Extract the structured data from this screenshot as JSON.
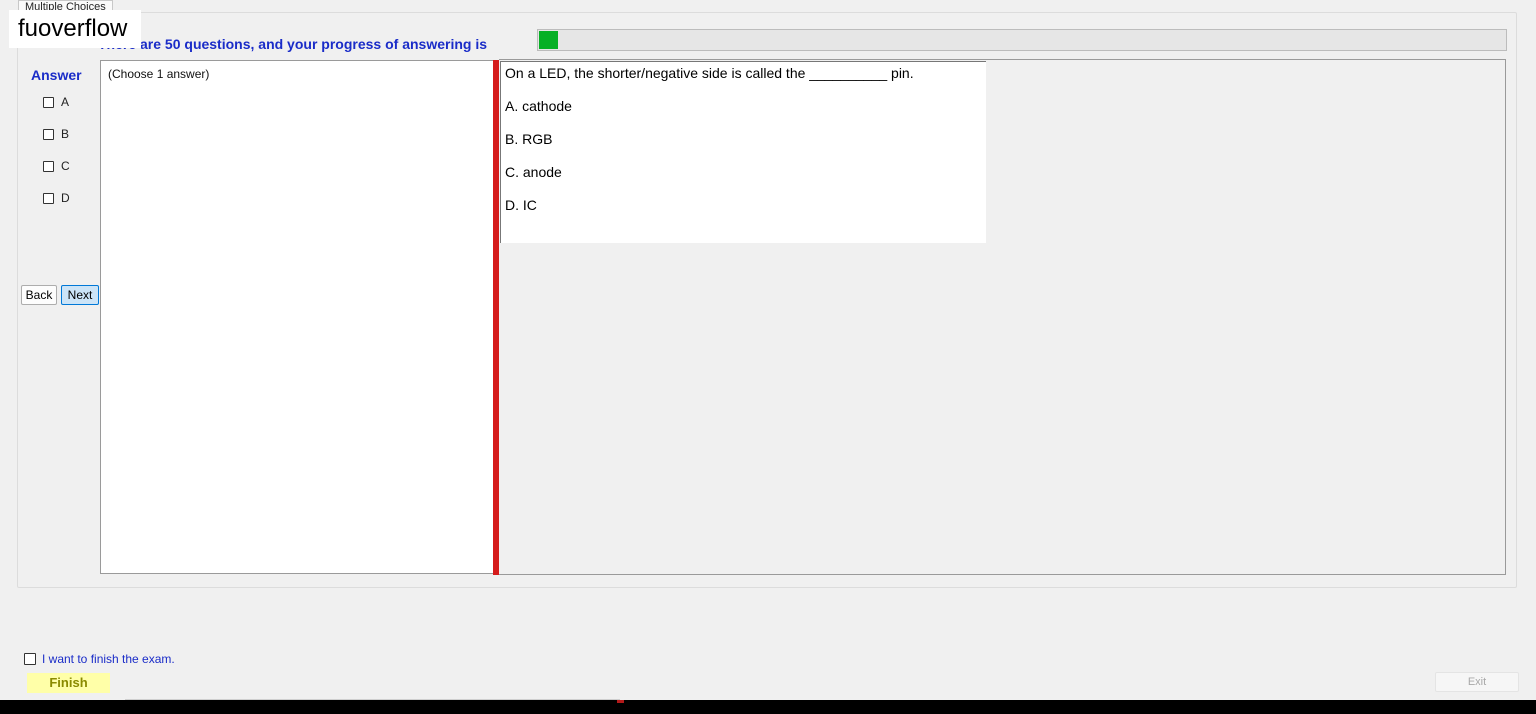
{
  "tab": {
    "label": "Multiple Choices"
  },
  "watermark": "fuoverflow",
  "progress": {
    "text": "There are 50 questions, and your progress of answering is",
    "fraction": 0.02
  },
  "answer": {
    "heading": "Answer",
    "options": [
      "A",
      "B",
      "C",
      "D"
    ]
  },
  "nav": {
    "back": "Back",
    "next": "Next"
  },
  "instruction": "(Choose 1 answer)",
  "question": {
    "text": "On a LED, the shorter/negative side is called the __________ pin.",
    "answers": [
      "A.  cathode",
      "B.  RGB",
      "C.  anode",
      "D.  IC"
    ]
  },
  "footer": {
    "finish_check_label": "I want to finish the exam.",
    "finish_button": "Finish",
    "exit_button": "Exit"
  },
  "colors": {
    "accent_blue": "#1a2cc8",
    "progress_green": "#06b025",
    "splitter_red": "#d51c1c",
    "finish_yellow": "#ffffa8"
  }
}
